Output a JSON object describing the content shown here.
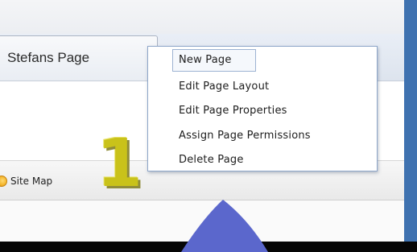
{
  "tab": {
    "label": "Stefans Page"
  },
  "menu": {
    "items": [
      {
        "label": "New Page"
      },
      {
        "label": "Edit Page Layout"
      },
      {
        "label": "Edit Page Properties"
      },
      {
        "label": "Assign Page Permissions"
      },
      {
        "label": "Delete Page"
      }
    ]
  },
  "footer": {
    "sitemap_label": "Site Map",
    "sitemap_icon": "sitemap-icon"
  },
  "annotation": {
    "step_number": "1"
  },
  "colors": {
    "border_blue": "#3f72b0",
    "pointer_blue": "#5b67cc",
    "step_yellow": "#c9c21a"
  }
}
